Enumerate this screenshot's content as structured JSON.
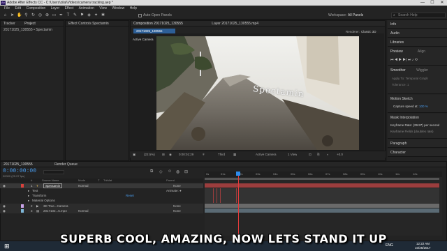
{
  "window": {
    "title": "Adobe After Effects CC - C:\\Users\\zilal\\Videos\\camera tracking.aep *",
    "minimize": "—",
    "maximize": "☐",
    "close": "✕"
  },
  "menu": [
    "File",
    "Edit",
    "Composition",
    "Layer",
    "Effect",
    "Animation",
    "View",
    "Window",
    "Help"
  ],
  "toolbar": {
    "auto_open_label": "Auto-Open Panels",
    "workspace_label": "Workspace:",
    "workspace_value": "All Panels",
    "search_placeholder": "Search Help"
  },
  "project_panel": {
    "tabs": [
      "Tracker",
      "Project"
    ],
    "item": "20171025_130555 • Spectamin"
  },
  "effect_controls": {
    "tab": "Effect Controls Spectamin"
  },
  "composition": {
    "tab": "Composition 20171025_130555",
    "layer_tab": "Layer 20171025_130555.mp4",
    "sub_tab": "20171025_130555",
    "renderer_label": "Renderer:",
    "renderer_value": "Classic 3D",
    "active_camera_label": "Active Camera",
    "text_overlay": "Spectamin",
    "zoom": "(22.5%)",
    "timecode": "0:00:01:29",
    "resolution": "Third",
    "camera_select": "Active Camera",
    "view_select": "1 View",
    "exposure": "+0.0"
  },
  "right_panels": {
    "info": "Info",
    "audio": "Audio",
    "libraries": "Libraries",
    "preview_tabs": [
      "Preview",
      "Align"
    ],
    "smoother_tabs": [
      "Smoother",
      "Wiggler"
    ],
    "apply_to_label": "Apply To:",
    "apply_to_value": "Temporal Graph",
    "tolerance_label": "Tolerance:",
    "tolerance_value": "1",
    "motion_sketch": "Motion Sketch",
    "capture_speed_label": "Capture speed at:",
    "capture_speed_value": "100 %",
    "mask_interpolation": "Mask Interpolation",
    "keyframe_rate_label": "Keyframe Rate:",
    "keyframe_rate_value": "(29.97)",
    "keyframe_rate_unit": "per second",
    "keyframe_fields_label": "Keyframe Fields (doubles rate)",
    "paragraph": "Paragraph",
    "character": "Character"
  },
  "timeline": {
    "tabs": [
      "20171025_130555",
      "Render Queue"
    ],
    "timecode": "0:00:00:00",
    "frame_info": "00000 (29.97 fps)",
    "headers": [
      "#",
      "Source Name",
      "Mode",
      "T",
      "TrkMat",
      "Parent"
    ],
    "layers": [
      {
        "num": "1",
        "name": "Spectamin",
        "mode": "Normal",
        "parent": "None"
      },
      {
        "num": "",
        "name": "Text",
        "mode": "",
        "parent": "Animate: ●"
      },
      {
        "num": "",
        "name": "Transform",
        "mode": "",
        "parent": "Reset"
      },
      {
        "num": "",
        "name": "Material Options",
        "mode": "",
        "parent": ""
      },
      {
        "num": "2",
        "name": "3D Trac...Camera",
        "mode": "",
        "parent": "None"
      },
      {
        "num": "3",
        "name": "2017102...5.mp4",
        "mode": "Normal",
        "parent": "None"
      }
    ],
    "ruler_labels": [
      "0s",
      "01s",
      "02s",
      "03s",
      "04s",
      "05s",
      "06s",
      "07s",
      "08s",
      "09s",
      "10s",
      "11s",
      "12s"
    ]
  },
  "taskbar": {
    "lang": "ENG",
    "time": "12:22 AM",
    "date": "10/26/2017"
  },
  "subtitle": "SUPERB COOL, AMAZING, NOW LETS STAND IT UP",
  "colors": {
    "accent": "#2d8ceb",
    "track_red": "#9b3d3d",
    "track_gray": "#5f5f5f",
    "layer_label_red": "#d9413c"
  }
}
